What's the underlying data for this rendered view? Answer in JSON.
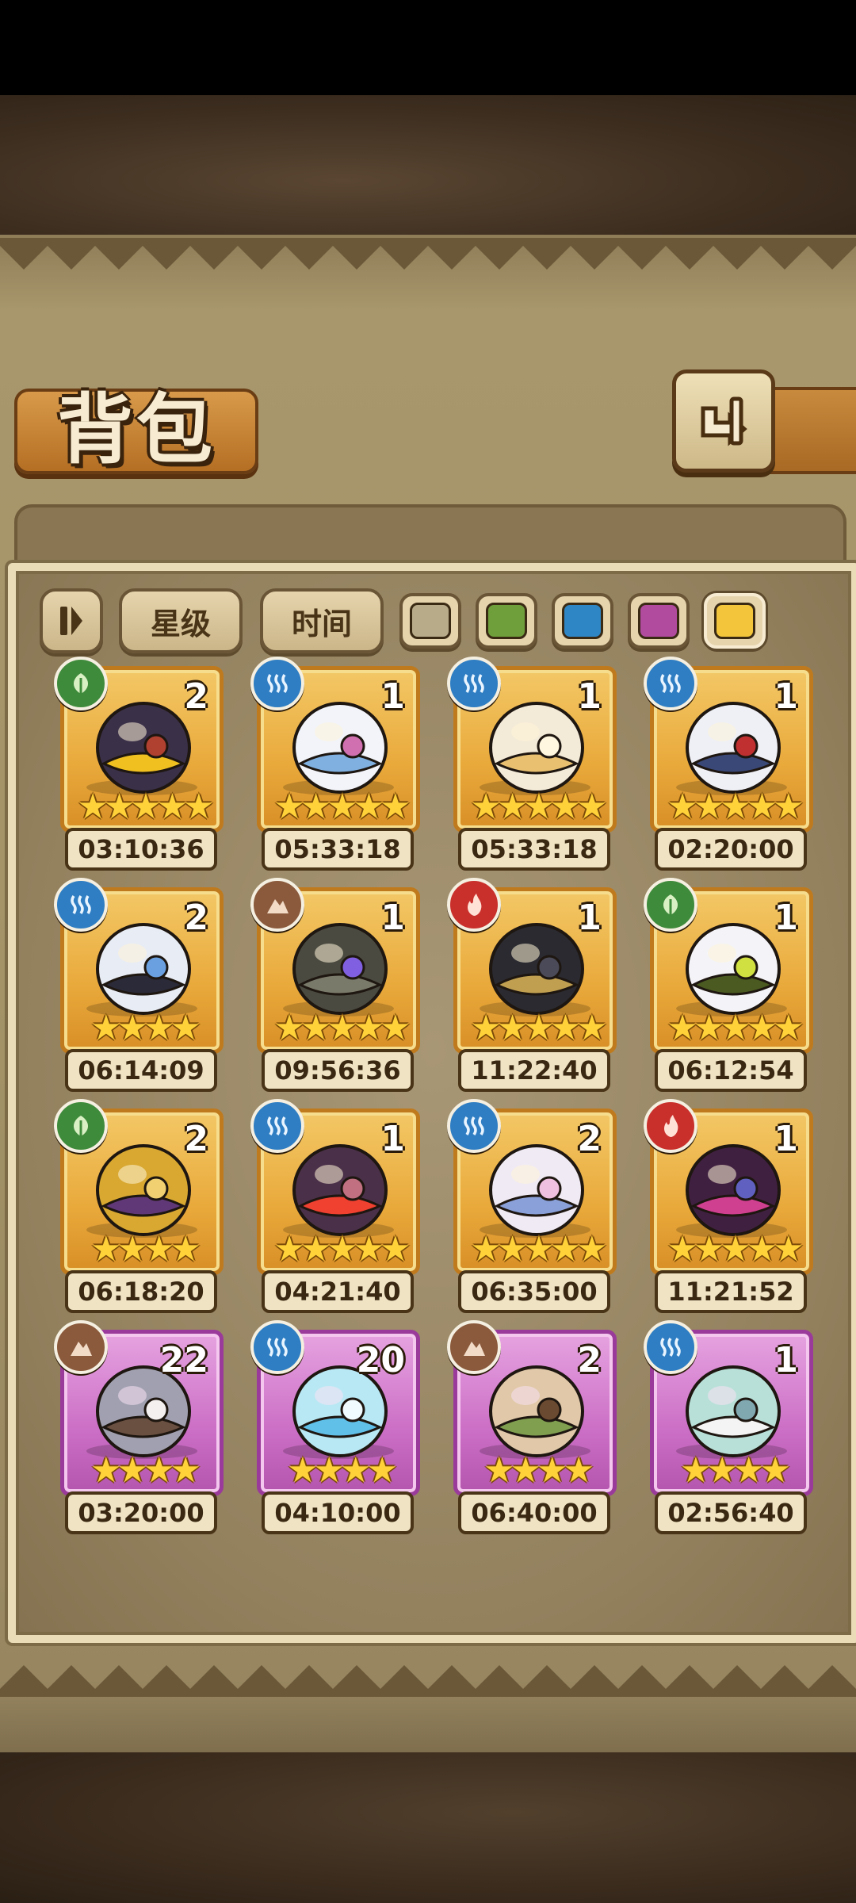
{
  "header": {
    "title": "背包",
    "back_label": "back"
  },
  "filters": {
    "sort_icon": "pause-bars-icon",
    "star_label": "星级",
    "time_label": "时间",
    "colors": [
      {
        "name": "gray",
        "hex": "#b7ab8a",
        "selected": false
      },
      {
        "name": "green",
        "hex": "#6e9f3a",
        "selected": false
      },
      {
        "name": "blue",
        "hex": "#2f86c4",
        "selected": false
      },
      {
        "name": "purple",
        "hex": "#b04b9e",
        "selected": false
      },
      {
        "name": "yellow",
        "hex": "#f2c53a",
        "selected": true
      }
    ]
  },
  "items": [
    {
      "element": "nature",
      "qty": "2",
      "stars": 5,
      "rarity": "gold",
      "time": "03:10:36",
      "art": "dragon-eye-egg"
    },
    {
      "element": "water",
      "qty": "1",
      "stars": 5,
      "rarity": "gold",
      "time": "05:33:18",
      "art": "ribbon-hat-egg"
    },
    {
      "element": "water",
      "qty": "1",
      "stars": 5,
      "rarity": "gold",
      "time": "05:33:18",
      "art": "angel-wing-egg"
    },
    {
      "element": "water",
      "qty": "1",
      "stars": 5,
      "rarity": "gold",
      "time": "02:20:00",
      "art": "frilled-egg"
    },
    {
      "element": "water",
      "qty": "2",
      "stars": 4,
      "rarity": "gold",
      "time": "06:14:09",
      "art": "armored-egg"
    },
    {
      "element": "earth",
      "qty": "1",
      "stars": 5,
      "rarity": "gold",
      "time": "09:56:36",
      "art": "pinecone-egg"
    },
    {
      "element": "fire",
      "qty": "1",
      "stars": 5,
      "rarity": "gold",
      "time": "11:22:40",
      "art": "pirate-hat-egg"
    },
    {
      "element": "nature",
      "qty": "1",
      "stars": 5,
      "rarity": "gold",
      "time": "06:12:54",
      "art": "leaf-wing-egg"
    },
    {
      "element": "nature",
      "qty": "2",
      "stars": 4,
      "rarity": "gold",
      "time": "06:18:20",
      "art": "magic-lamp"
    },
    {
      "element": "water",
      "qty": "1",
      "stars": 5,
      "rarity": "gold",
      "time": "04:21:40",
      "art": "rune-egg"
    },
    {
      "element": "water",
      "qty": "2",
      "stars": 5,
      "rarity": "gold",
      "time": "06:35:00",
      "art": "swirl-egg"
    },
    {
      "element": "fire",
      "qty": "1",
      "stars": 5,
      "rarity": "gold",
      "time": "11:21:52",
      "art": "orb-egg"
    },
    {
      "element": "earth",
      "qty": "22",
      "stars": 4,
      "rarity": "purple",
      "time": "03:20:00",
      "art": "sword-egg"
    },
    {
      "element": "water",
      "qty": "20",
      "stars": 4,
      "rarity": "purple",
      "time": "04:10:00",
      "art": "water-drop"
    },
    {
      "element": "earth",
      "qty": "2",
      "stars": 4,
      "rarity": "purple",
      "time": "06:40:00",
      "art": "vine-egg"
    },
    {
      "element": "water",
      "qty": "1",
      "stars": 4,
      "rarity": "purple",
      "time": "02:56:40",
      "art": "web-egg"
    }
  ]
}
